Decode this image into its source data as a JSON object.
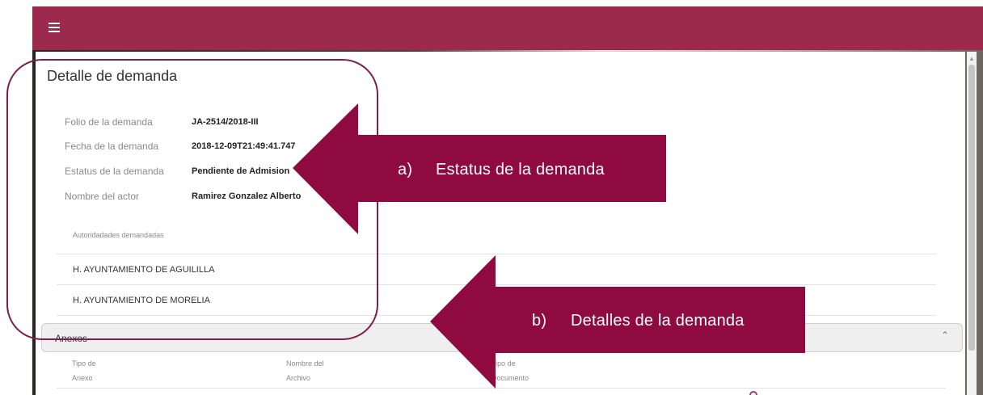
{
  "page": {
    "title": "Detalle de demanda"
  },
  "fields": [
    {
      "label": "Folio de la demanda",
      "value": "JA-2514/2018-III"
    },
    {
      "label": "Fecha de la demanda",
      "value": "2018-12-09T21:49:41.747"
    },
    {
      "label": "Estatus de la demanda",
      "value": "Pendiente de Admision"
    },
    {
      "label": "Nombre del actor",
      "value": "Ramirez Gonzalez Alberto"
    }
  ],
  "authorities": {
    "caption": "Autoridadades demandadas",
    "items": [
      "H. AYUNTAMIENTO DE AGUILILLA",
      "H. AYUNTAMIENTO DE MORELIA"
    ]
  },
  "anexos": {
    "label": "Anexos",
    "columns": [
      {
        "line1": "Tipo de",
        "line2": "Anexo"
      },
      {
        "line1": "Nombre del",
        "line2": "Archivo"
      },
      {
        "line1": "Tipo de",
        "line2": "Documento"
      }
    ]
  },
  "annotations": {
    "a": {
      "letter": "a)",
      "text": "Estatus de la demanda"
    },
    "b": {
      "letter": "b)",
      "text": "Detalles de la demanda"
    }
  },
  "colors": {
    "topbar": "#9c2a4f",
    "annotation": "#8e0a40"
  },
  "icons": {
    "menu": "hamburger-icon",
    "collapse": "chevron-up-icon",
    "scroll_up": "triangle-up-icon"
  }
}
